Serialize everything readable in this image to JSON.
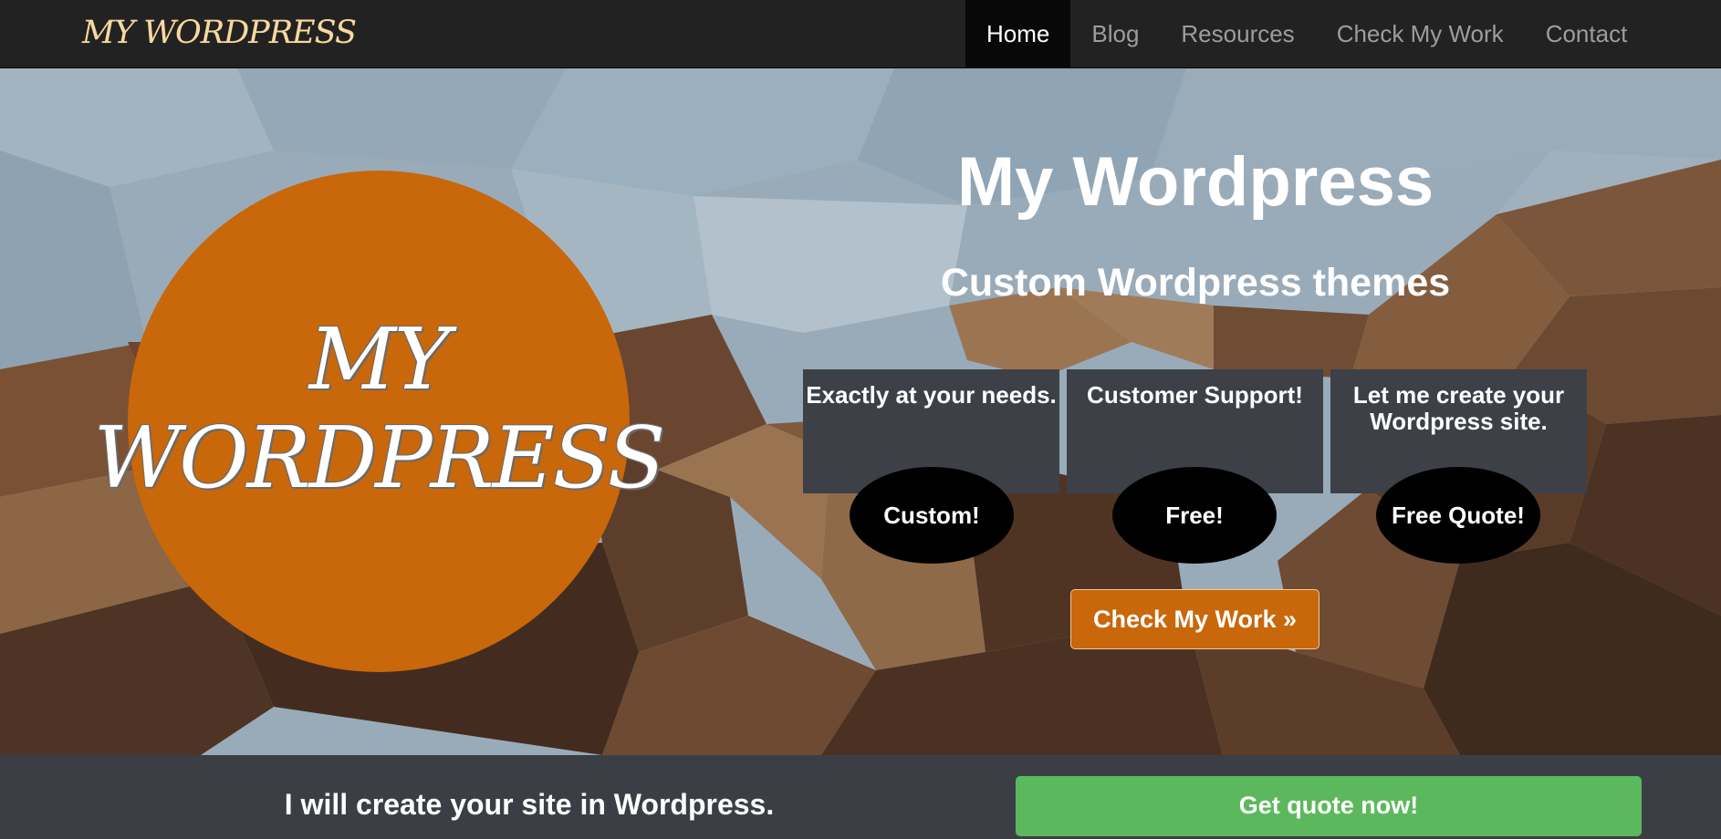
{
  "navbar": {
    "brand": "MY WORDPRESS",
    "items": [
      {
        "label": "Home",
        "active": true
      },
      {
        "label": "Blog",
        "active": false
      },
      {
        "label": "Resources",
        "active": false
      },
      {
        "label": "Check My Work",
        "active": false
      },
      {
        "label": "Contact",
        "active": false
      }
    ]
  },
  "hero": {
    "logo_line1": "MY",
    "logo_line2": "WORDPRESS",
    "title": "My Wordpress",
    "subtitle": "Custom Wordpress themes",
    "features": [
      {
        "text": "Exactly at your needs.",
        "button": "Custom!"
      },
      {
        "text": "Customer Support!",
        "button": "Free!"
      },
      {
        "text": "Let me create your Wordpress site.",
        "button": "Free Quote!"
      }
    ],
    "work_button": "Check My Work »"
  },
  "cta": {
    "text": "I will create your site in Wordpress.",
    "button": "Get quote now!"
  },
  "colors": {
    "accent_orange": "#c9670b",
    "cta_green": "#5cb85c",
    "navbar_bg": "#222222",
    "panel_bg": "#3d4047"
  }
}
